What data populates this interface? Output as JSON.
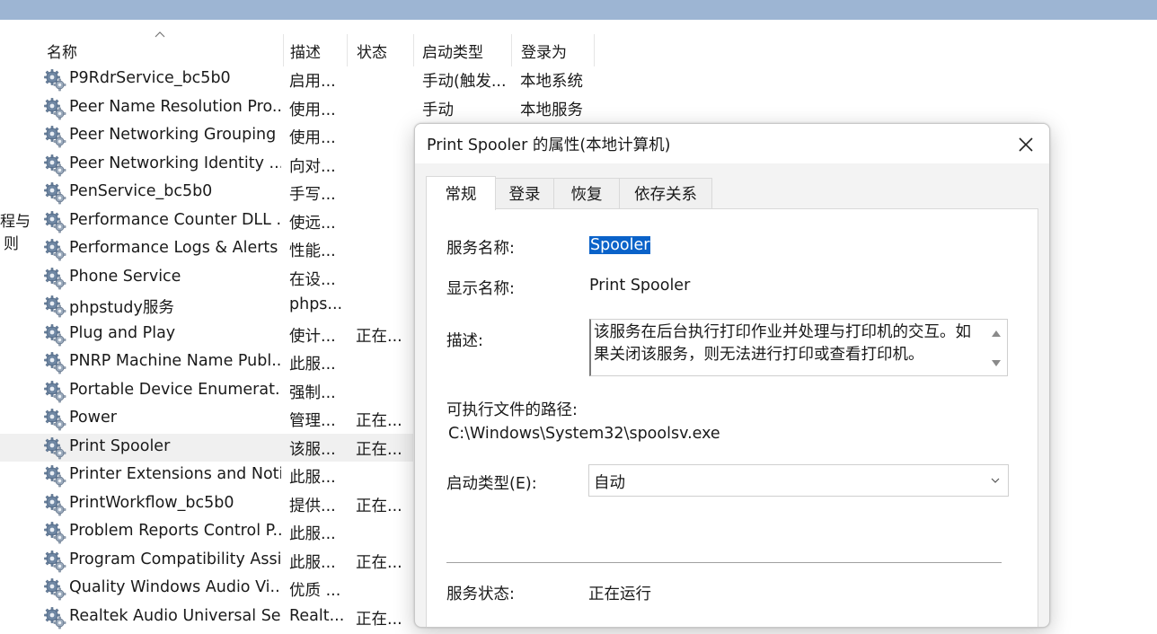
{
  "left_cut": [
    "程与",
    "则"
  ],
  "columns": {
    "name": "名称",
    "desc": "描述",
    "status": "状态",
    "startup_type": "启动类型",
    "logon_as": "登录为"
  },
  "services": [
    {
      "name": "P9RdrService_bc5b0",
      "desc": "启用...",
      "status": "",
      "startup": "手动(触发...",
      "logon": "本地系统"
    },
    {
      "name": "Peer Name Resolution Pro...",
      "desc": "使用...",
      "status": "",
      "startup": "手动",
      "logon": "本地服务"
    },
    {
      "name": "Peer Networking Grouping",
      "desc": "使用...",
      "status": "",
      "startup": "",
      "logon": ""
    },
    {
      "name": "Peer Networking Identity ...",
      "desc": "向对...",
      "status": "",
      "startup": "",
      "logon": ""
    },
    {
      "name": "PenService_bc5b0",
      "desc": "手写...",
      "status": "",
      "startup": "",
      "logon": ""
    },
    {
      "name": "Performance Counter DLL ...",
      "desc": "使远...",
      "status": "",
      "startup": "",
      "logon": ""
    },
    {
      "name": "Performance Logs & Alerts",
      "desc": "性能...",
      "status": "",
      "startup": "",
      "logon": ""
    },
    {
      "name": "Phone Service",
      "desc": "在设...",
      "status": "",
      "startup": "",
      "logon": ""
    },
    {
      "name": "phpstudy服务",
      "desc": "phps...",
      "status": "",
      "startup": "",
      "logon": ""
    },
    {
      "name": "Plug and Play",
      "desc": "使计...",
      "status": "正在...",
      "startup": "",
      "logon": ""
    },
    {
      "name": "PNRP Machine Name Publ...",
      "desc": "此服...",
      "status": "",
      "startup": "",
      "logon": ""
    },
    {
      "name": "Portable Device Enumerat...",
      "desc": "强制...",
      "status": "",
      "startup": "",
      "logon": ""
    },
    {
      "name": "Power",
      "desc": "管理...",
      "status": "正在...",
      "startup": "",
      "logon": ""
    },
    {
      "name": "Print Spooler",
      "desc": "该服...",
      "status": "正在...",
      "startup": "",
      "logon": ""
    },
    {
      "name": "Printer Extensions and Noti...",
      "desc": "此服...",
      "status": "",
      "startup": "",
      "logon": ""
    },
    {
      "name": "PrintWorkflow_bc5b0",
      "desc": "提供...",
      "status": "正在...",
      "startup": "",
      "logon": ""
    },
    {
      "name": "Problem Reports Control P...",
      "desc": "此服...",
      "status": "",
      "startup": "",
      "logon": ""
    },
    {
      "name": "Program Compatibility Assi...",
      "desc": "此服...",
      "status": "正在...",
      "startup": "",
      "logon": ""
    },
    {
      "name": "Quality Windows Audio Vi...",
      "desc": "优质 ...",
      "status": "",
      "startup": "",
      "logon": ""
    },
    {
      "name": "Realtek Audio Universal Se...",
      "desc": "Realt...",
      "status": "正在...",
      "startup": "",
      "logon": ""
    }
  ],
  "selected_index": 13,
  "dialog": {
    "title": "Print Spooler 的属性(本地计算机)",
    "tabs": [
      "常规",
      "登录",
      "恢复",
      "依存关系"
    ],
    "active_tab": 0,
    "service_name_label": "服务名称:",
    "service_name": "Spooler",
    "display_name_label": "显示名称:",
    "display_name": "Print Spooler",
    "description_label": "描述:",
    "description": "该服务在后台执行打印作业并处理与打印机的交互。如果关闭该服务，则无法进行打印或查看打印机。",
    "exe_path_label": "可执行文件的路径:",
    "exe_path": "C:\\Windows\\System32\\spoolsv.exe",
    "startup_type_label": "启动类型(E):",
    "startup_type_value": "自动",
    "service_status_label": "服务状态:",
    "service_status": "正在运行"
  },
  "colors": {
    "selection_blue": "#0a62c9",
    "top_band": "#9db5d3",
    "row_selected": "#f0f0f0"
  },
  "icons": {
    "service": "gears-icon",
    "close": "close-icon",
    "sort": "sort-caret-up-icon",
    "dropdown": "chevron-down-icon"
  }
}
